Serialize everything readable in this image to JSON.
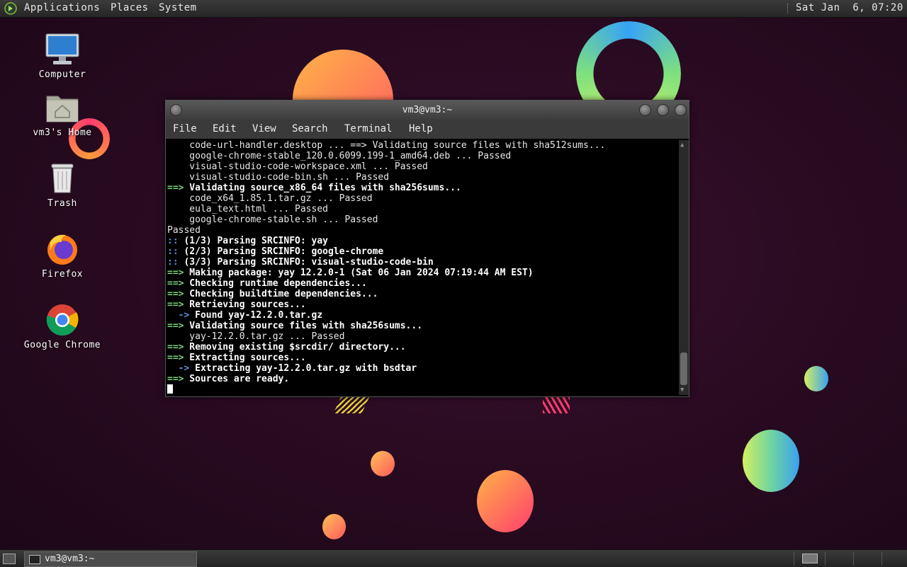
{
  "top_panel": {
    "menus": [
      "Applications",
      "Places",
      "System"
    ],
    "clock": "Sat Jan  6, 07:20"
  },
  "desktop_icons": [
    {
      "label": "Computer",
      "icon": "computer-icon"
    },
    {
      "label": "vm3's Home",
      "icon": "home-folder-icon"
    },
    {
      "label": "Trash",
      "icon": "trash-icon"
    },
    {
      "label": "Firefox",
      "icon": "firefox-icon"
    },
    {
      "label": "Google Chrome",
      "icon": "chrome-icon"
    }
  ],
  "terminal": {
    "title": "vm3@vm3:~",
    "menu": [
      "File",
      "Edit",
      "View",
      "Search",
      "Terminal",
      "Help"
    ],
    "lines": [
      {
        "p": "",
        "t": "    code-url-handler.desktop ... ==> Validating source files with sha512sums..."
      },
      {
        "p": "",
        "t": "    google-chrome-stable_120.0.6099.199-1_amd64.deb ... Passed"
      },
      {
        "p": "",
        "t": "    visual-studio-code-workspace.xml ... Passed"
      },
      {
        "p": "",
        "t": "    visual-studio-code-bin.sh ... Passed"
      },
      {
        "p": "==>",
        "t": " Validating source_x86_64 files with sha256sums..."
      },
      {
        "p": "",
        "t": "    code_x64_1.85.1.tar.gz ... Passed"
      },
      {
        "p": "",
        "t": "    eula_text.html ... Passed"
      },
      {
        "p": "",
        "t": "    google-chrome-stable.sh ... Passed"
      },
      {
        "p": "",
        "t": "Passed"
      },
      {
        "p": "::",
        "t": " (1/3) Parsing SRCINFO: yay"
      },
      {
        "p": "::",
        "t": " (2/3) Parsing SRCINFO: google-chrome"
      },
      {
        "p": "::",
        "t": " (3/3) Parsing SRCINFO: visual-studio-code-bin"
      },
      {
        "p": "==>",
        "t": " Making package: yay 12.2.0-1 (Sat 06 Jan 2024 07:19:44 AM EST)"
      },
      {
        "p": "==>",
        "t": " Checking runtime dependencies..."
      },
      {
        "p": "==>",
        "t": " Checking buildtime dependencies..."
      },
      {
        "p": "==>",
        "t": " Retrieving sources..."
      },
      {
        "p": "  ->",
        "t": " Found yay-12.2.0.tar.gz"
      },
      {
        "p": "==>",
        "t": " Validating source files with sha256sums..."
      },
      {
        "p": "",
        "t": "    yay-12.2.0.tar.gz ... Passed"
      },
      {
        "p": "==>",
        "t": " Removing existing $srcdir/ directory..."
      },
      {
        "p": "==>",
        "t": " Extracting sources..."
      },
      {
        "p": "  ->",
        "t": " Extracting yay-12.2.0.tar.gz with bsdtar"
      },
      {
        "p": "==>",
        "t": " Sources are ready."
      }
    ]
  },
  "taskbar": {
    "window_label": "vm3@vm3:~"
  }
}
